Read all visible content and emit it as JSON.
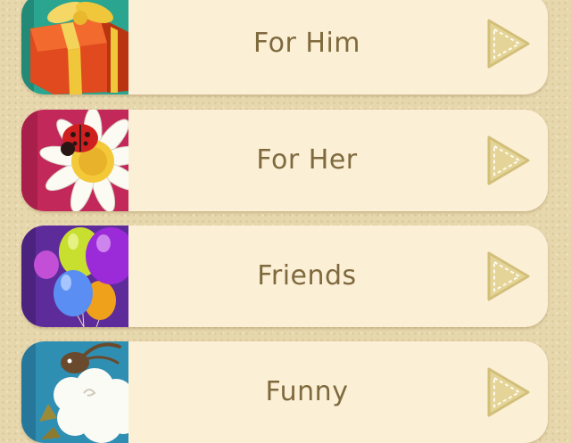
{
  "categories": [
    {
      "label": "For Him",
      "icon": "gift-box-icon",
      "tile_color": "#2aa58f"
    },
    {
      "label": "For Her",
      "icon": "daisy-ladybug-icon",
      "tile_color": "#c2285a"
    },
    {
      "label": "Friends",
      "icon": "balloons-icon",
      "tile_color": "#5d2c9a"
    },
    {
      "label": "Funny",
      "icon": "sheep-icon",
      "tile_color": "#2f8fb3"
    }
  ],
  "accent_color": "#d9c98d"
}
